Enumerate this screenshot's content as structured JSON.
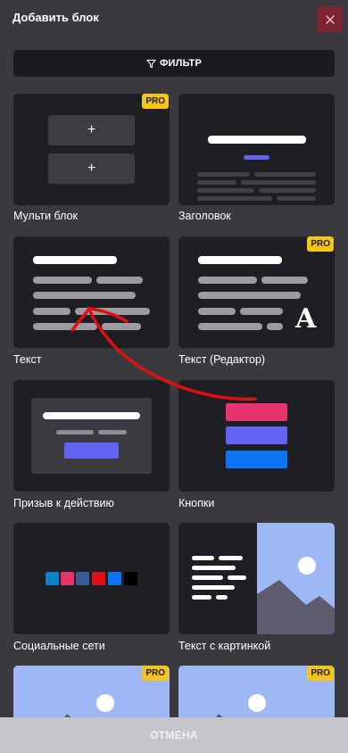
{
  "header": {
    "title": "Добавить блок"
  },
  "filter": {
    "label": "ФИЛЬТР",
    "icon": "filter-icon"
  },
  "badge": {
    "pro": "PRO"
  },
  "blocks": [
    {
      "label": "Мульти блок",
      "pro": true
    },
    {
      "label": "Заголовок",
      "pro": false
    },
    {
      "label": "Текст",
      "pro": false
    },
    {
      "label": "Текст (Редактор)",
      "pro": true
    },
    {
      "label": "Призыв к действию",
      "pro": false
    },
    {
      "label": "Кнопки",
      "pro": false
    },
    {
      "label": "Социальные сети",
      "pro": false
    },
    {
      "label": "Текст с картинкой",
      "pro": false
    },
    {
      "label": "",
      "pro": true
    },
    {
      "label": "",
      "pro": true
    }
  ],
  "multi_block": {
    "plus_symbol": "+"
  },
  "editor_glyph": "A",
  "footer": {
    "cancel_label": "ОТМЕНА"
  },
  "colors": {
    "accent_purple": "#6262f3",
    "pink": "#e8336d",
    "blue": "#0a74f5",
    "pro_yellow": "#f5c518",
    "arrow_red": "#e01010",
    "social_swatches": [
      "#0a84c8",
      "#e8336d",
      "#3b5998",
      "#e0101a",
      "#0a74f5",
      "#000000"
    ]
  }
}
